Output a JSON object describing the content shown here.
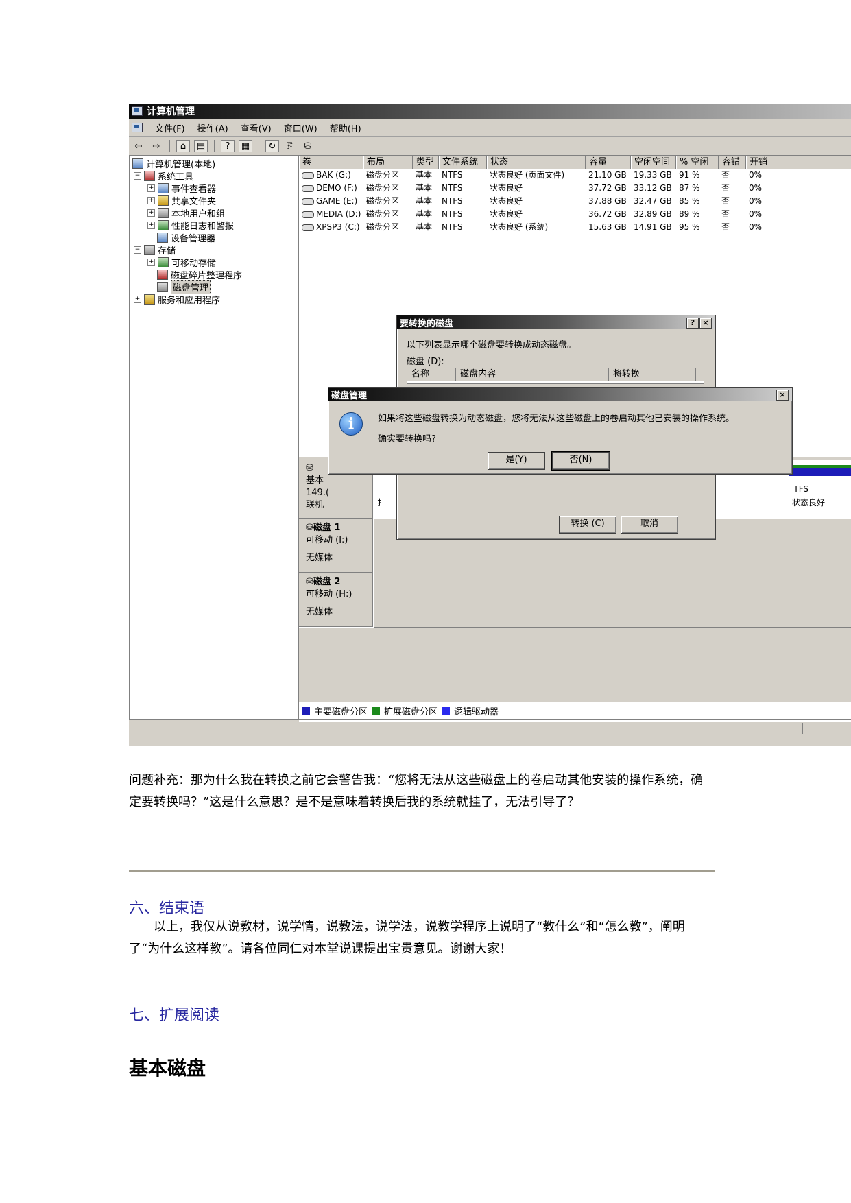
{
  "window": {
    "title": "计算机管理",
    "menu": [
      "文件(F)",
      "操作(A)",
      "查看(V)",
      "窗口(W)",
      "帮助(H)"
    ]
  },
  "tree": [
    {
      "label": "计算机管理(本地)",
      "icon": "computer-icon"
    },
    {
      "label": "系统工具",
      "icon": "tools-icon"
    },
    {
      "label": "事件查看器",
      "icon": "event-viewer-icon"
    },
    {
      "label": "共享文件夹",
      "icon": "shared-folder-icon"
    },
    {
      "label": "本地用户和组",
      "icon": "users-icon"
    },
    {
      "label": "性能日志和警报",
      "icon": "performance-icon"
    },
    {
      "label": "设备管理器",
      "icon": "device-manager-icon"
    },
    {
      "label": "存储",
      "icon": "storage-icon"
    },
    {
      "label": "可移动存储",
      "icon": "removable-storage-icon"
    },
    {
      "label": "磁盘碎片整理程序",
      "icon": "defrag-icon"
    },
    {
      "label": "磁盘管理",
      "icon": "disk-management-icon"
    },
    {
      "label": "服务和应用程序",
      "icon": "services-icon"
    }
  ],
  "volumes": {
    "columns": [
      "卷",
      "布局",
      "类型",
      "文件系统",
      "状态",
      "容量",
      "空闲空间",
      "% 空闲",
      "容错",
      "开销"
    ],
    "rows": [
      [
        "BAK (G:)",
        "磁盘分区",
        "基本",
        "NTFS",
        "状态良好 (页面文件)",
        "21.10 GB",
        "19.33 GB",
        "91 %",
        "否",
        "0%"
      ],
      [
        "DEMO (F:)",
        "磁盘分区",
        "基本",
        "NTFS",
        "状态良好",
        "37.72 GB",
        "33.12 GB",
        "87 %",
        "否",
        "0%"
      ],
      [
        "GAME (E:)",
        "磁盘分区",
        "基本",
        "NTFS",
        "状态良好",
        "37.88 GB",
        "32.47 GB",
        "85 %",
        "否",
        "0%"
      ],
      [
        "MEDIA (D:)",
        "磁盘分区",
        "基本",
        "NTFS",
        "状态良好",
        "36.72 GB",
        "32.89 GB",
        "89 %",
        "否",
        "0%"
      ],
      [
        "XPSP3 (C:)",
        "磁盘分区",
        "基本",
        "NTFS",
        "状态良好 (系统)",
        "15.63 GB",
        "14.91 GB",
        "95 %",
        "否",
        "0%"
      ]
    ]
  },
  "disks": {
    "disk0": {
      "line1": "基本",
      "line2": "149.(",
      "line3": "联机",
      "partial_right_1": "TFS",
      "partial_right_2": "状态良好",
      "partial_mid": "扌"
    },
    "disk1": {
      "name": "磁盘 1",
      "type": "可移动 (I:)",
      "media": "无媒体"
    },
    "disk2": {
      "name": "磁盘 2",
      "type": "可移动 (H:)",
      "media": "无媒体"
    }
  },
  "legend": [
    "主要磁盘分区",
    "扩展磁盘分区",
    "逻辑驱动器"
  ],
  "colors": {
    "primary": "#1d1db8",
    "extended": "#1c8a1c",
    "logical": "#2a2aee"
  },
  "convert_dialog": {
    "title": "要转换的磁盘",
    "help": "?",
    "close": "×",
    "desc": "以下列表显示哪个磁盘要转换成动态磁盘。",
    "disks_label": "磁盘 (D):",
    "columns": [
      "名称",
      "磁盘内容",
      "将转换"
    ],
    "convert_button": "转换 (C)",
    "cancel_button": "取消"
  },
  "confirm_dialog": {
    "title": "磁盘管理",
    "close": "×",
    "message": "如果将这些磁盘转换为动态磁盘，您将无法从这些磁盘上的卷启动其他已安装的操作系统。",
    "question": "确实要转换吗?",
    "yes": "是(Y)",
    "no": "否(N)"
  },
  "doc": {
    "para1": "问题补充：那为什么我在转换之前它会警告我：“您将无法从这些磁盘上的卷启动其他安装的操作系统，确定要转换吗？”这是什么意思？是不是意味着转换后我的系统就挂了，无法引导了？",
    "section6": "六、结束语",
    "para2": "以上，我仅从说教材，说学情，说教法，说学法，说教学程序上说明了“教什么”和“怎么教”，阐明了“为什么这样教”。请各位同仁对本堂说课提出宝贵意见。谢谢大家！",
    "section7": "七、扩展阅读",
    "heading": "基本磁盘"
  }
}
